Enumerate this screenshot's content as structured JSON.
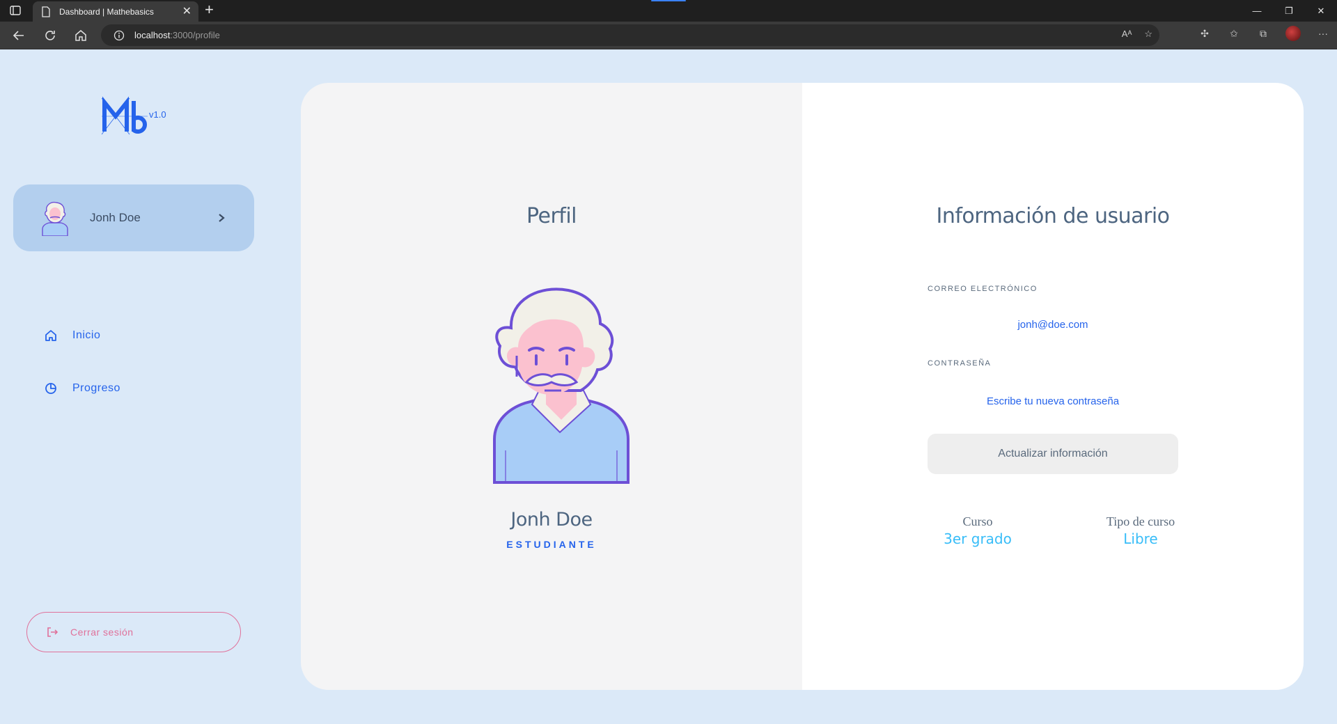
{
  "browser": {
    "tab_title": "Dashboard | Mathebasics",
    "url_host": "localhost",
    "url_path": ":3000/profile"
  },
  "sidebar": {
    "logo_text": "Mb",
    "logo_version": "v1.0",
    "user_name": "Jonh Doe",
    "nav": [
      {
        "label": "Inicio",
        "icon": "home-icon"
      },
      {
        "label": "Progreso",
        "icon": "pie-chart-icon"
      }
    ],
    "logout_label": "Cerrar sesión"
  },
  "profile": {
    "title": "Perfil",
    "name": "Jonh Doe",
    "role": "ESTUDIANTE"
  },
  "user_info": {
    "title": "Información de usuario",
    "email_label": "CORREO ELECTRÓNICO",
    "email_value": "jonh@doe.com",
    "password_label": "CONTRASEÑA",
    "password_placeholder": "Escribe tu nueva contraseña",
    "update_button": "Actualizar información",
    "course_label": "Curso",
    "course_value": "3er grado",
    "course_type_label": "Tipo de curso",
    "course_type_value": "Libre"
  },
  "colors": {
    "accent": "#2563eb",
    "page_bg": "#dbe9f8",
    "user_card_bg": "#b3cfee",
    "logout": "#e0719a",
    "stat_value": "#38bdf8"
  }
}
